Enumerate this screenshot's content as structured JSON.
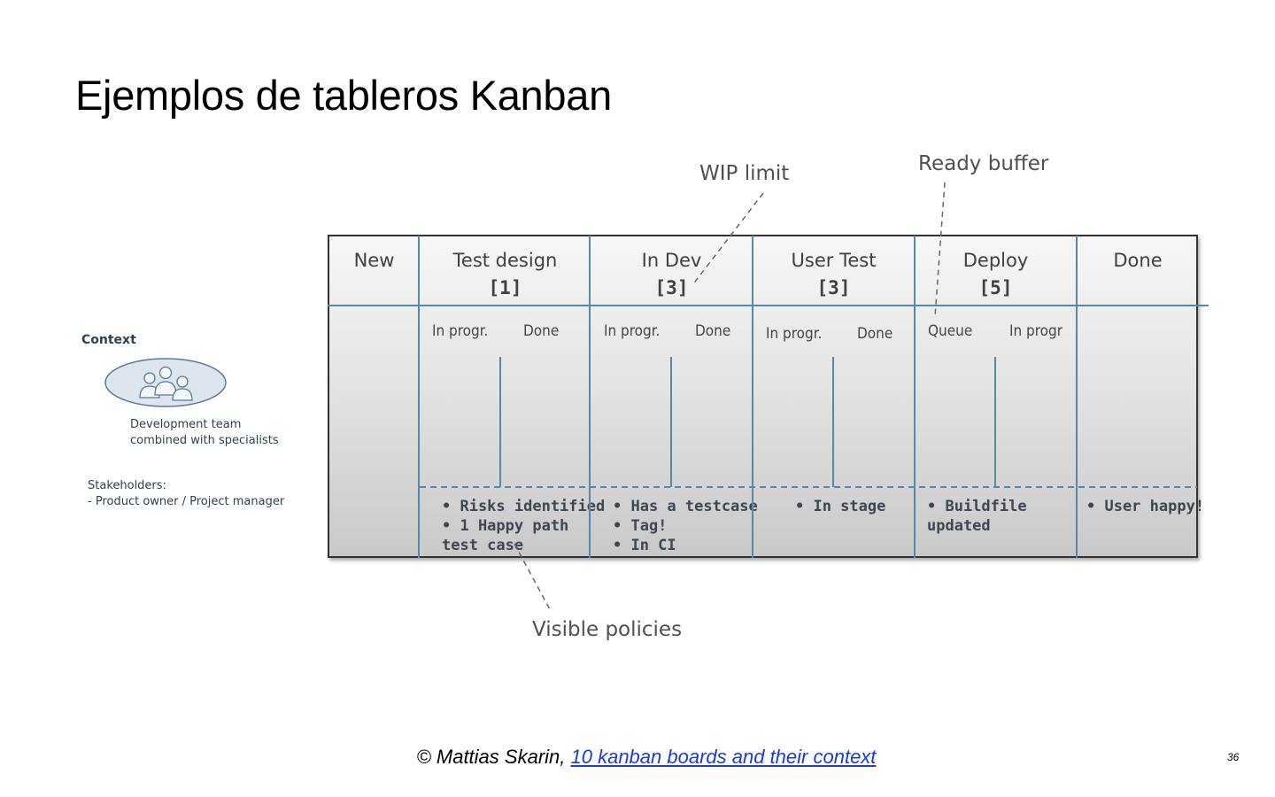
{
  "slide": {
    "title": "Ejemplos de tableros Kanban",
    "page_number": "36"
  },
  "context": {
    "label": "Context",
    "team_lines": [
      "Development team",
      "combined with specialists"
    ],
    "stakeholder_lines": [
      "Stakeholders:",
      "- Product owner / Project manager"
    ]
  },
  "board": {
    "columns": [
      {
        "name": "New",
        "wip": ""
      },
      {
        "name": "Test design",
        "wip": "[1]"
      },
      {
        "name": "In Dev",
        "wip": "[3]"
      },
      {
        "name": "User Test",
        "wip": "[3]"
      },
      {
        "name": "Deploy",
        "wip": "[5]"
      },
      {
        "name": "Done",
        "wip": ""
      }
    ],
    "sub_columns": [
      {
        "left": "In progr.",
        "right": "Done"
      },
      {
        "left": "In progr.",
        "right": "Done"
      },
      {
        "left": "In progr.",
        "right": "Done"
      },
      {
        "left": "Queue",
        "right": "In progr"
      }
    ],
    "policies": [
      [
        "• Risks identified",
        "• 1 Happy path",
        "test case"
      ],
      [
        "• Has a testcase",
        "• Tag!",
        "• In CI"
      ],
      [
        "• In stage"
      ],
      [
        "• Buildfile",
        "updated"
      ],
      [
        "• User happy!"
      ]
    ]
  },
  "annotations": {
    "wip_limit": "WIP limit",
    "ready_buffer": "Ready buffer",
    "visible_policies": "Visible policies"
  },
  "footer": {
    "credit": "© Mattias Skarin, ",
    "link_text": "10 kanban boards and their context"
  },
  "colors": {
    "divider": "#5a86a8",
    "board_border": "#333333",
    "link": "#1a3bd6"
  }
}
